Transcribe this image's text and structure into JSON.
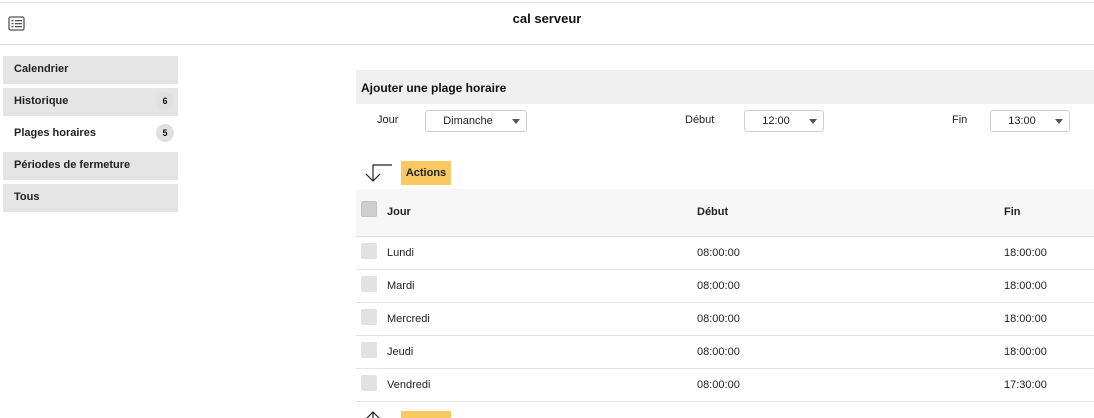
{
  "header": {
    "title": "cal serveur",
    "menu_icon": "list-icon"
  },
  "sidebar": {
    "items": [
      {
        "label": "Calendrier",
        "badge": ""
      },
      {
        "label": "Historique",
        "badge": "6"
      },
      {
        "label": "Plages horaires",
        "badge": "5",
        "active": true
      },
      {
        "label": "Périodes de fermeture",
        "badge": ""
      },
      {
        "label": "Tous",
        "badge": ""
      }
    ]
  },
  "add_form": {
    "title": "Ajouter une plage horaire",
    "day_label": "Jour",
    "day_value": "Dimanche",
    "start_label": "Début",
    "start_value": "12:00",
    "end_label": "Fin",
    "end_value": "13:00"
  },
  "actions": {
    "label": "Actions"
  },
  "table": {
    "columns": [
      "Jour",
      "Début",
      "Fin"
    ],
    "rows": [
      {
        "day": "Lundi",
        "start": "08:00:00",
        "end": "18:00:00"
      },
      {
        "day": "Mardi",
        "start": "08:00:00",
        "end": "18:00:00"
      },
      {
        "day": "Mercredi",
        "start": "08:00:00",
        "end": "18:00:00"
      },
      {
        "day": "Jeudi",
        "start": "08:00:00",
        "end": "18:00:00"
      },
      {
        "day": "Vendredi",
        "start": "08:00:00",
        "end": "17:30:00"
      }
    ]
  },
  "colors": {
    "accent": "#f7c95e",
    "panel": "#efefef",
    "sidebar_item": "#e5e5e5"
  }
}
